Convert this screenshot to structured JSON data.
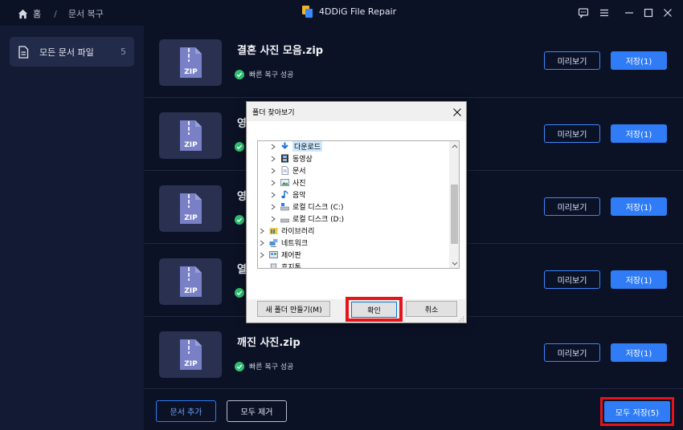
{
  "titlebar": {
    "home_label": "홈",
    "breadcrumb": "문서 복구",
    "app_title": "4DDiG File Repair",
    "controls": [
      "feedback-icon",
      "menu-icon",
      "minimize-icon",
      "maximize-icon",
      "close-icon"
    ]
  },
  "sidebar": {
    "items": [
      {
        "label": "모든 문서 파일",
        "count": "5",
        "icon": "document-icon"
      }
    ]
  },
  "files": [
    {
      "name": "결혼 사진 모음.zip",
      "status": "빠른 복구 성공",
      "preview_label": "미리보기",
      "save_label": "저장(1)"
    },
    {
      "name": "영",
      "status": "",
      "preview_label": "미리보기",
      "save_label": "저장(1)"
    },
    {
      "name": "영",
      "status": "",
      "preview_label": "미리보기",
      "save_label": "저장(1)"
    },
    {
      "name": "열",
      "status": "",
      "preview_label": "미리보기",
      "save_label": "저장(1)"
    },
    {
      "name": "깨진 사진.zip",
      "status": "빠른 복구 성공",
      "preview_label": "미리보기",
      "save_label": "저장(1)"
    }
  ],
  "thumb_label": "ZIP",
  "footer": {
    "add_label": "문서 추가",
    "remove_all_label": "모두 제거",
    "save_all_label": "모두 저장(5)"
  },
  "dialog": {
    "title": "폴더 찾아보기",
    "tree": [
      {
        "label": "다운로드",
        "level": 1,
        "icon": "download-arrow-icon",
        "selected": true
      },
      {
        "label": "동영상",
        "level": 1,
        "icon": "film-icon"
      },
      {
        "label": "문서",
        "level": 1,
        "icon": "document-icon"
      },
      {
        "label": "사진",
        "level": 1,
        "icon": "picture-icon"
      },
      {
        "label": "음악",
        "level": 1,
        "icon": "music-note-icon"
      },
      {
        "label": "로컬 디스크 (C:)",
        "level": 1,
        "icon": "drive-icon"
      },
      {
        "label": "로컬 디스크 (D:)",
        "level": 1,
        "icon": "drive-icon"
      },
      {
        "label": "라이브러리",
        "level": 0,
        "icon": "library-icon"
      },
      {
        "label": "네트워크",
        "level": 0,
        "icon": "network-icon"
      },
      {
        "label": "제어판",
        "level": 0,
        "icon": "control-panel-icon"
      },
      {
        "label": "휴지통",
        "level": 0,
        "icon": "recycle-bin-icon"
      }
    ],
    "new_folder_label": "새 폴더 만들기(M)",
    "ok_label": "확인",
    "cancel_label": "취소"
  },
  "colors": {
    "background": "#0c1226",
    "sidebar": "#131a33",
    "accent": "#2f7cf6",
    "success": "#2fbf71",
    "highlight": "#e5141b"
  }
}
